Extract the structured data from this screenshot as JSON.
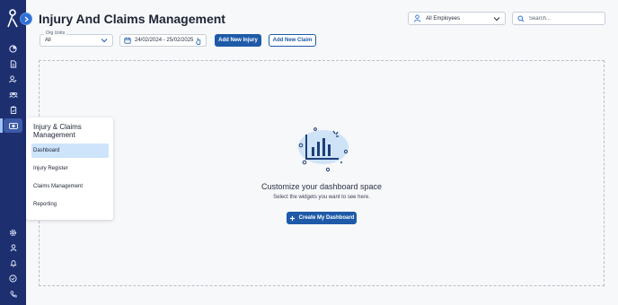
{
  "header": {
    "title": "Injury And Claims Management"
  },
  "employee_filter": {
    "value": "All Employees",
    "icon": "person-icon"
  },
  "search": {
    "placeholder": "Search..."
  },
  "filters": {
    "org_units_label": "Org Units",
    "org_units_value": "All",
    "date_range": "24/02/2024 - 25/02/2025"
  },
  "actions": {
    "add_injury": "Add New Injury",
    "add_claim": "Add New Claim"
  },
  "empty_state": {
    "title": "Customize your dashboard space",
    "subtitle": "Select the widgets you want to see here.",
    "button": "Create My Dashboard"
  },
  "flyout": {
    "title": "Injury & Claims Management",
    "items": [
      {
        "label": "Dashboard",
        "active": true
      },
      {
        "label": "Injury Register",
        "active": false
      },
      {
        "label": "Claims Management",
        "active": false
      },
      {
        "label": "Reporting",
        "active": false
      }
    ]
  },
  "rail": {
    "top_icons": [
      "pie-chart-icon",
      "document-icon",
      "user-settings-icon",
      "group-icon",
      "clipboard-icon",
      "injury-claims-icon"
    ],
    "bottom_icons": [
      "gear-icon",
      "user-icon",
      "bell-icon",
      "check-circle-icon",
      "phone-icon"
    ]
  },
  "colors": {
    "rail": "#1d2f6f",
    "primary": "#1e5aa8",
    "active_item": "#cde4fb"
  }
}
